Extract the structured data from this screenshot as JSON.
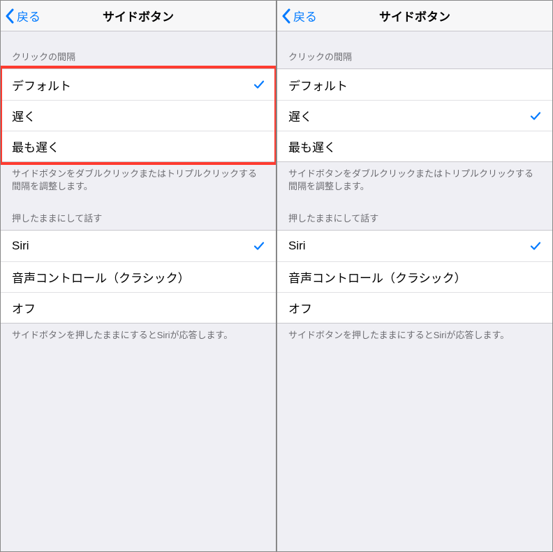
{
  "panels": [
    {
      "nav": {
        "back": "戻る",
        "title": "サイドボタン"
      },
      "section1": {
        "header": "クリックの間隔",
        "items": [
          {
            "label": "デフォルト",
            "checked": true
          },
          {
            "label": "遅く",
            "checked": false
          },
          {
            "label": "最も遅く",
            "checked": false
          }
        ],
        "footer": "サイドボタンをダブルクリックまたはトリプルクリックする間隔を調整します。",
        "highlighted": true
      },
      "section2": {
        "header": "押したままにして話す",
        "items": [
          {
            "label": "Siri",
            "checked": true
          },
          {
            "label": "音声コントロール（クラシック）",
            "checked": false
          },
          {
            "label": "オフ",
            "checked": false
          }
        ],
        "footer": "サイドボタンを押したままにするとSiriが応答します。"
      }
    },
    {
      "nav": {
        "back": "戻る",
        "title": "サイドボタン"
      },
      "section1": {
        "header": "クリックの間隔",
        "items": [
          {
            "label": "デフォルト",
            "checked": false
          },
          {
            "label": "遅く",
            "checked": true
          },
          {
            "label": "最も遅く",
            "checked": false
          }
        ],
        "footer": "サイドボタンをダブルクリックまたはトリプルクリックする間隔を調整します。",
        "highlighted": false
      },
      "section2": {
        "header": "押したままにして話す",
        "items": [
          {
            "label": "Siri",
            "checked": true
          },
          {
            "label": "音声コントロール（クラシック）",
            "checked": false
          },
          {
            "label": "オフ",
            "checked": false
          }
        ],
        "footer": "サイドボタンを押したままにするとSiriが応答します。"
      }
    }
  ],
  "colors": {
    "accent": "#007aff",
    "highlight": "#ff3b30"
  }
}
